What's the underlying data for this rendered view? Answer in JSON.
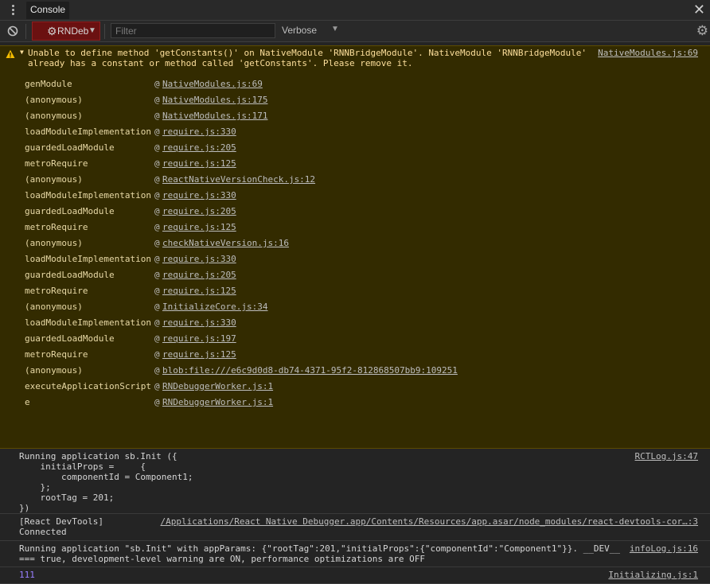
{
  "tabbar": {
    "tab_label": "Console",
    "close_glyph": "✕"
  },
  "toolbar": {
    "context_label": "RNDeb",
    "filter_placeholder": "Filter",
    "filter_value": "",
    "levels_label": "Verbose",
    "settings_glyph": "⚙",
    "context_color": "#6b1111"
  },
  "warning": {
    "message": "Unable to define method 'getConstants()' on NativeModule 'RNNBridgeModule'. NativeModule 'RNNBridgeModule'\nalready has a constant or method called 'getConstants'. Please remove it.",
    "source": "NativeModules.js:69",
    "at_symbol": "@",
    "stack": [
      {
        "fn": "genModule",
        "loc": "NativeModules.js:69"
      },
      {
        "fn": "(anonymous)",
        "loc": "NativeModules.js:175"
      },
      {
        "fn": "(anonymous)",
        "loc": "NativeModules.js:171"
      },
      {
        "fn": "loadModuleImplementation",
        "loc": "require.js:330"
      },
      {
        "fn": "guardedLoadModule",
        "loc": "require.js:205"
      },
      {
        "fn": "metroRequire",
        "loc": "require.js:125"
      },
      {
        "fn": "(anonymous)",
        "loc": "ReactNativeVersionCheck.js:12"
      },
      {
        "fn": "loadModuleImplementation",
        "loc": "require.js:330"
      },
      {
        "fn": "guardedLoadModule",
        "loc": "require.js:205"
      },
      {
        "fn": "metroRequire",
        "loc": "require.js:125"
      },
      {
        "fn": "(anonymous)",
        "loc": "checkNativeVersion.js:16"
      },
      {
        "fn": "loadModuleImplementation",
        "loc": "require.js:330"
      },
      {
        "fn": "guardedLoadModule",
        "loc": "require.js:205"
      },
      {
        "fn": "metroRequire",
        "loc": "require.js:125"
      },
      {
        "fn": "(anonymous)",
        "loc": "InitializeCore.js:34"
      },
      {
        "fn": "loadModuleImplementation",
        "loc": "require.js:330"
      },
      {
        "fn": "guardedLoadModule",
        "loc": "require.js:197"
      },
      {
        "fn": "metroRequire",
        "loc": "require.js:125"
      },
      {
        "fn": "(anonymous)",
        "loc": "blob:file:///e6c9d0d8-db74-4371-95f2-812868507bb9:109251"
      },
      {
        "fn": "executeApplicationScript",
        "loc": "RNDebuggerWorker.js:1"
      },
      {
        "fn": "e",
        "loc": "RNDebuggerWorker.js:1"
      }
    ]
  },
  "messages": [
    {
      "text": "Running application sb.Init ({\n    initialProps =     {\n        componentId = Component1;\n    };\n    rootTag = 201;\n})",
      "source": "RCTLog.js:47"
    },
    {
      "text": "[React DevTools]\nConnected",
      "source": "/Applications/React Native Debugger.app/Contents/Resources/app.asar/node_modules/react-devtools-cor…:3"
    },
    {
      "text": "Running application \"sb.Init\" with appParams: {\"rootTag\":201,\"initialProps\":{\"componentId\":\"Component1\"}}. __DEV__\n=== true, development-level warning are ON, performance optimizations are OFF",
      "source": "infoLog.js:16"
    },
    {
      "text": "111",
      "source": "Initializing.js:1"
    }
  ],
  "colors": {
    "background": "#242424",
    "warning_bg": "#332b00",
    "warning_text": "#fddf9c",
    "number": "#9980ff"
  }
}
